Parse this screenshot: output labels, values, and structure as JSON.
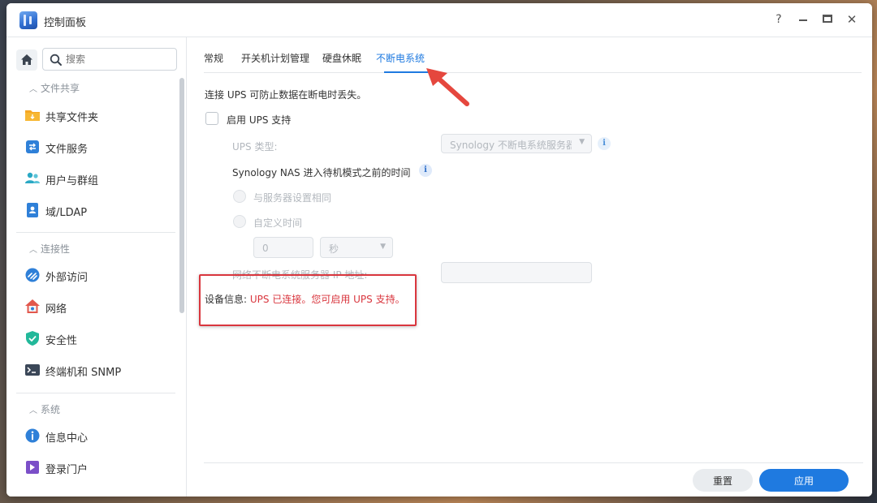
{
  "window": {
    "title": "控制面板",
    "controls": {
      "help": "?",
      "close": "✕"
    }
  },
  "sidebar": {
    "search_placeholder": "搜索",
    "sections": [
      {
        "label": "文件共享",
        "items": [
          {
            "label": "共享文件夹",
            "icon": "shared-folder-icon"
          },
          {
            "label": "文件服务",
            "icon": "file-services-icon"
          },
          {
            "label": "用户与群组",
            "icon": "users-groups-icon"
          },
          {
            "label": "域/LDAP",
            "icon": "domain-ldap-icon"
          }
        ]
      },
      {
        "label": "连接性",
        "items": [
          {
            "label": "外部访问",
            "icon": "external-access-icon"
          },
          {
            "label": "网络",
            "icon": "network-icon"
          },
          {
            "label": "安全性",
            "icon": "security-icon"
          },
          {
            "label": "终端机和 SNMP",
            "icon": "terminal-snmp-icon"
          }
        ]
      },
      {
        "label": "系统",
        "items": [
          {
            "label": "信息中心",
            "icon": "info-center-icon"
          },
          {
            "label": "登录门户",
            "icon": "login-portal-icon"
          }
        ]
      }
    ]
  },
  "main": {
    "tabs": [
      {
        "label": "常规",
        "active": false
      },
      {
        "label": "开关机计划管理",
        "active": false
      },
      {
        "label": "硬盘休眠",
        "active": false
      },
      {
        "label": "不断电系统",
        "active": true
      }
    ],
    "description": "连接 UPS 可防止数据在断电时丢失。",
    "enable_ups": {
      "label": "启用 UPS 支持",
      "checked": false
    },
    "ups_type": {
      "label": "UPS 类型:",
      "value": "Synology 不断电系统服务器"
    },
    "standby": {
      "label": "Synology NAS 进入待机模式之前的时间",
      "options": [
        "与服务器设置相同",
        "自定义时间"
      ],
      "time_value": "0",
      "time_unit": "秒"
    },
    "server_ip_label": "网络不断电系统服务器 IP 地址:",
    "device_info": {
      "key": "设备信息:",
      "value": "UPS 已连接。您可启用 UPS 支持。"
    },
    "buttons": {
      "reset": "重置",
      "apply": "应用"
    }
  },
  "colors": {
    "accent": "#1f7ae0",
    "alert": "#d9363e"
  }
}
